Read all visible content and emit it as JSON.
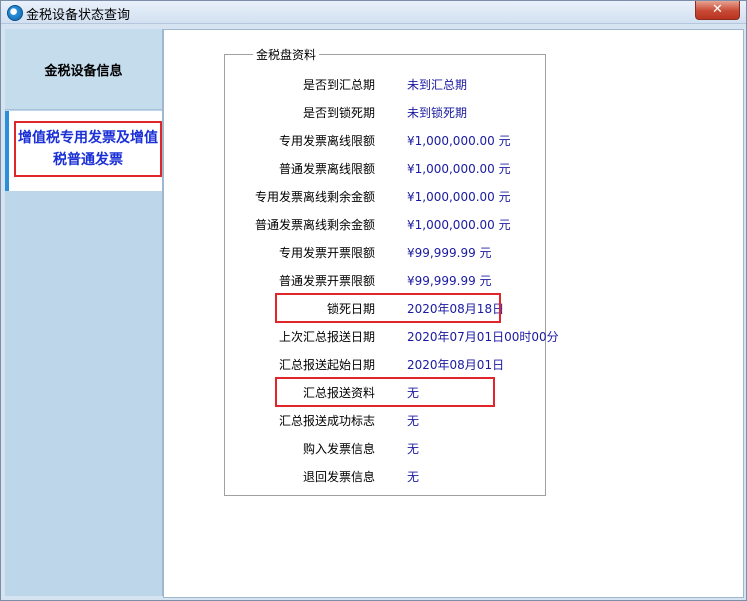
{
  "window": {
    "title": "金税设备状态查询",
    "close_label": "✕"
  },
  "sidebar": {
    "tab_device_info": "金税设备信息",
    "tab_vat_invoice": "增值税专用发票及增值税普通发票"
  },
  "group": {
    "legend": "金税盘资料",
    "rows": [
      {
        "label": "是否到汇总期",
        "value": "未到汇总期"
      },
      {
        "label": "是否到锁死期",
        "value": "未到锁死期"
      },
      {
        "label": "专用发票离线限额",
        "value": "¥1,000,000.00 元"
      },
      {
        "label": "普通发票离线限额",
        "value": "¥1,000,000.00 元"
      },
      {
        "label": "专用发票离线剩余金额",
        "value": "¥1,000,000.00 元"
      },
      {
        "label": "普通发票离线剩余金额",
        "value": "¥1,000,000.00 元"
      },
      {
        "label": "专用发票开票限额",
        "value": "¥99,999.99 元"
      },
      {
        "label": "普通发票开票限额",
        "value": "¥99,999.99 元"
      },
      {
        "label": "锁死日期",
        "value": "2020年08月18日"
      },
      {
        "label": "上次汇总报送日期",
        "value": "2020年07月01日00时00分"
      },
      {
        "label": "汇总报送起始日期",
        "value": "2020年08月01日"
      },
      {
        "label": "汇总报送资料",
        "value": "无"
      },
      {
        "label": "汇总报送成功标志",
        "value": "无"
      },
      {
        "label": "购入发票信息",
        "value": "无"
      },
      {
        "label": "退回发票信息",
        "value": "无"
      }
    ]
  }
}
